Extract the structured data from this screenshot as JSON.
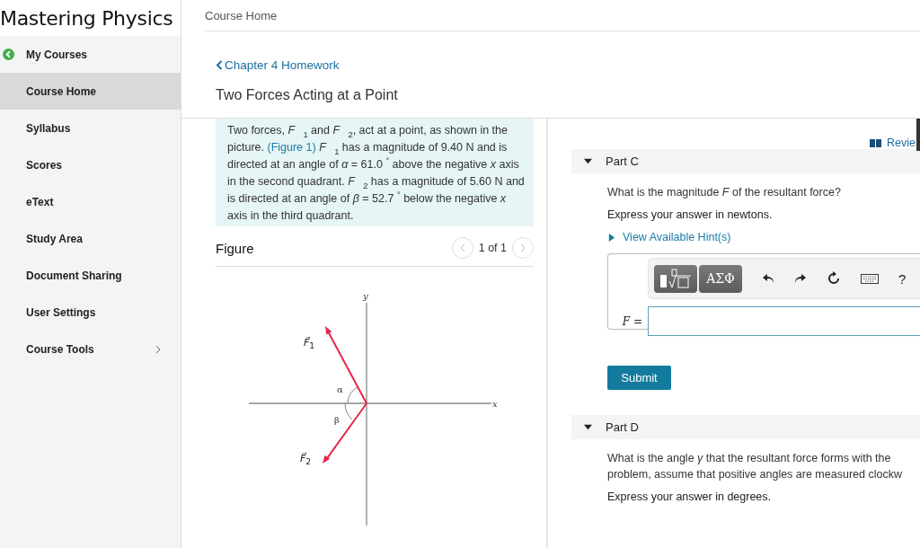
{
  "brand": "Mastering Physics",
  "sidebar": {
    "items": [
      {
        "label": "My Courses",
        "kind": "back",
        "selected": false
      },
      {
        "label": "Course Home",
        "kind": "plain",
        "selected": true
      },
      {
        "label": "Syllabus",
        "kind": "plain",
        "selected": false
      },
      {
        "label": "Scores",
        "kind": "plain",
        "selected": false
      },
      {
        "label": "eText",
        "kind": "plain",
        "selected": false
      },
      {
        "label": "Study Area",
        "kind": "plain",
        "selected": false
      },
      {
        "label": "Document Sharing",
        "kind": "plain",
        "selected": false
      },
      {
        "label": "User Settings",
        "kind": "plain",
        "selected": false
      },
      {
        "label": "Course Tools",
        "kind": "expandable",
        "selected": false
      }
    ]
  },
  "breadcrumb": "Course Home",
  "back_link": "Chapter 4 Homework",
  "title": "Two Forces Acting at a Point",
  "problem": [
    {
      "kind": "text",
      "text": "Two forces, *F⃗*$_{1}$ and *F⃗*$_{2}$, act at a point, as shown in the picture. "
    },
    {
      "kind": "link",
      "text": "(Figure 1)"
    },
    {
      "kind": "text",
      "text": " *F⃗*$_{1}$ has a magnitude of 9.40 N and is directed at an angle of *α* = 61.0 $^{°}$ above the negative *x* axis in the second quadrant. *F⃗*$_{2}$ has a magnitude of 5.60 N and is directed at an angle of *β* = 52.7 $^{°}$ below the negative *x* axis in the third quadrant."
    }
  ],
  "figure": {
    "heading": "Figure",
    "pager": "1 of 1",
    "axis_y": "y",
    "axis_x": "x",
    "alpha": "α",
    "beta": "β",
    "f1": "*F⃗*$_{1}$",
    "f2": "*F⃗*$_{2}$"
  },
  "review_link": "Revie",
  "parts": [
    {
      "title": "Part C",
      "expanded": true,
      "question": [
        "What is the magnitude *F* of the resultant force?"
      ],
      "instruction": "Express your answer in newtons.",
      "hint_link": "View Available Hint(s)",
      "answer": {
        "symbols": "ΑΣΦ",
        "help": "?",
        "label": "*F* ="
      },
      "submit": "Submit"
    },
    {
      "title": "Part D",
      "expanded": true,
      "question": [
        "What is the angle *γ* that the resultant force forms with the",
        "problem, assume that positive angles are measured clockw"
      ],
      "instruction": "Express your answer in degrees."
    }
  ]
}
